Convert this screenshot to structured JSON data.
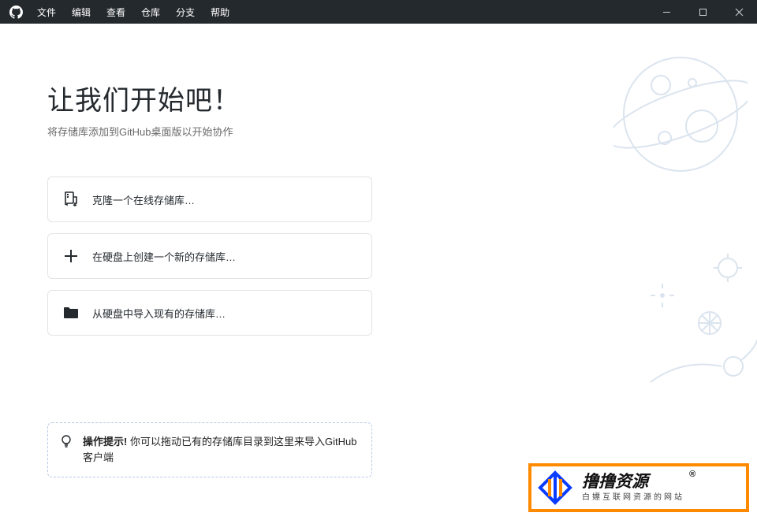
{
  "menu": {
    "items": [
      {
        "label": "文件"
      },
      {
        "label": "编辑"
      },
      {
        "label": "查看"
      },
      {
        "label": "仓库"
      },
      {
        "label": "分支"
      },
      {
        "label": "帮助"
      }
    ]
  },
  "main": {
    "heading": "让我们开始吧！",
    "subheading": "将存储库添加到GitHub桌面版以开始协作",
    "options": [
      {
        "label": "克隆一个在线存储库…",
        "icon": "repo-clone-icon"
      },
      {
        "label": "在硬盘上创建一个新的存储库…",
        "icon": "plus-icon"
      },
      {
        "label": "从硬盘中导入现有的存储库…",
        "icon": "folder-icon"
      }
    ],
    "tip": {
      "title": "操作提示!",
      "text": "你可以拖动已有的存储库目录到这里来导入GitHub客户端"
    }
  },
  "banner": {
    "title": "撸撸资源",
    "registered": "®",
    "subtitle": "白嫖互联网资源的网站"
  }
}
